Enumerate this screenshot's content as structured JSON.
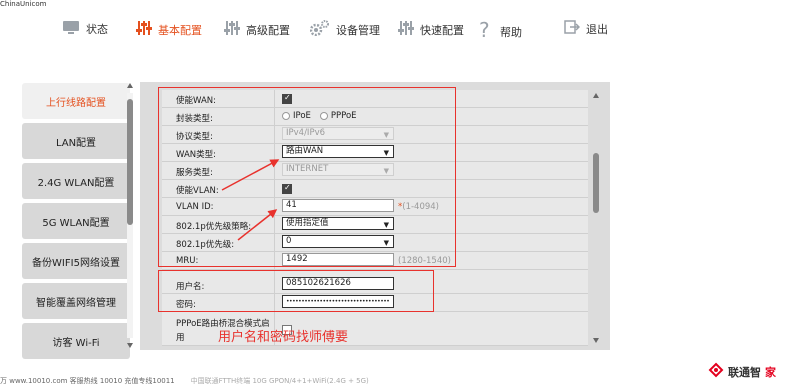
{
  "watermark": "ChinaUnicom",
  "nav": {
    "items": [
      {
        "label": "状态",
        "icon": "monitor-icon"
      },
      {
        "label": "基本配置",
        "icon": "sliders-icon"
      },
      {
        "label": "高级配置",
        "icon": "sliders-icon"
      },
      {
        "label": "设备管理",
        "icon": "gears-icon"
      },
      {
        "label": "快速配置",
        "icon": "sliders-icon"
      },
      {
        "label": "帮助",
        "icon": "help-icon"
      },
      {
        "label": "退出",
        "icon": "logout-icon"
      }
    ],
    "active": "基本配置",
    "active_color": "#e4501e"
  },
  "sidebar": {
    "items": [
      {
        "label": "上行线路配置"
      },
      {
        "label": "LAN配置"
      },
      {
        "label": "2.4G WLAN配置"
      },
      {
        "label": "5G WLAN配置"
      },
      {
        "label": "备份WIFI5网络设置"
      },
      {
        "label": "智能覆盖网络管理"
      },
      {
        "label": "访客 Wi-Fi"
      }
    ]
  },
  "form": {
    "enable_wan": {
      "label": "使能WAN:",
      "checked": true
    },
    "encap": {
      "label": "封装类型:",
      "options": [
        "IPoE",
        "PPPoE"
      ]
    },
    "protocol": {
      "label": "协议类型:",
      "value": "IPv4/IPv6"
    },
    "wan_type": {
      "label": "WAN类型:",
      "value": "路由WAN"
    },
    "service": {
      "label": "服务类型:",
      "value": "INTERNET"
    },
    "enable_vlan": {
      "label": "使能VLAN:",
      "checked": true
    },
    "vlan_id": {
      "label": "VLAN ID:",
      "value": "41",
      "hint": "(1-4094)",
      "required": "*"
    },
    "p8021_policy": {
      "label": "802.1p优先级策略:",
      "value": "使用指定值"
    },
    "p8021": {
      "label": "802.1p优先级:",
      "value": "0"
    },
    "mru": {
      "label": "MRU:",
      "value": "1492",
      "hint": "(1280-1540)"
    },
    "username": {
      "label": "用户名:",
      "value": "085102621626"
    },
    "password": {
      "label": "密码:",
      "value": "••••••••••••••••••••••••••••••••••"
    },
    "bridge": {
      "label": "PPPoE路由桥混合模式启用"
    }
  },
  "annotation": {
    "text": "用户名和密码找师傅要",
    "color": "#e8322d"
  },
  "footer": {
    "text": "万 www.10010.com 客服热线 10010 充值专线10011",
    "tag": "中国联通FTTH终端 10G GPON/4+1+WiFi(2.4G + 5G)"
  },
  "logo": {
    "text": "联通智",
    "red_text": "家"
  }
}
